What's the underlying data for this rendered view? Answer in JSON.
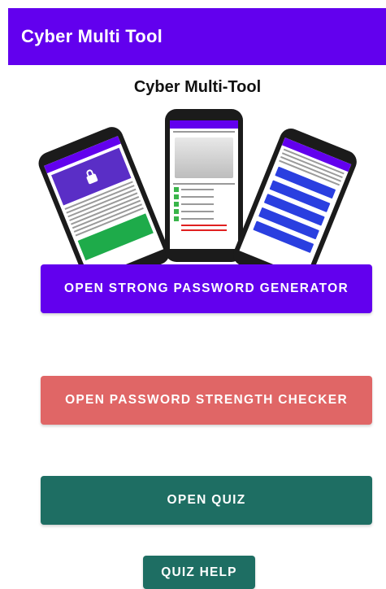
{
  "appbar": {
    "title": "Cyber Multi Tool",
    "color": "#6200ee"
  },
  "banner": {
    "title": "Cyber Multi-Tool",
    "phones": [
      "password-generator-screen",
      "strength-checker-screen",
      "quiz-screen"
    ]
  },
  "buttons": {
    "generator": {
      "label": "OPEN STRONG PASSWORD GENERATOR",
      "color": "#6200ee"
    },
    "checker": {
      "label": "OPEN PASSWORD STRENGTH CHECKER",
      "color": "#e06666"
    },
    "quiz": {
      "label": "OPEN QUIZ",
      "color": "#1e6e63"
    },
    "help": {
      "label": "QUIZ HELP",
      "color": "#1e6e63"
    }
  }
}
